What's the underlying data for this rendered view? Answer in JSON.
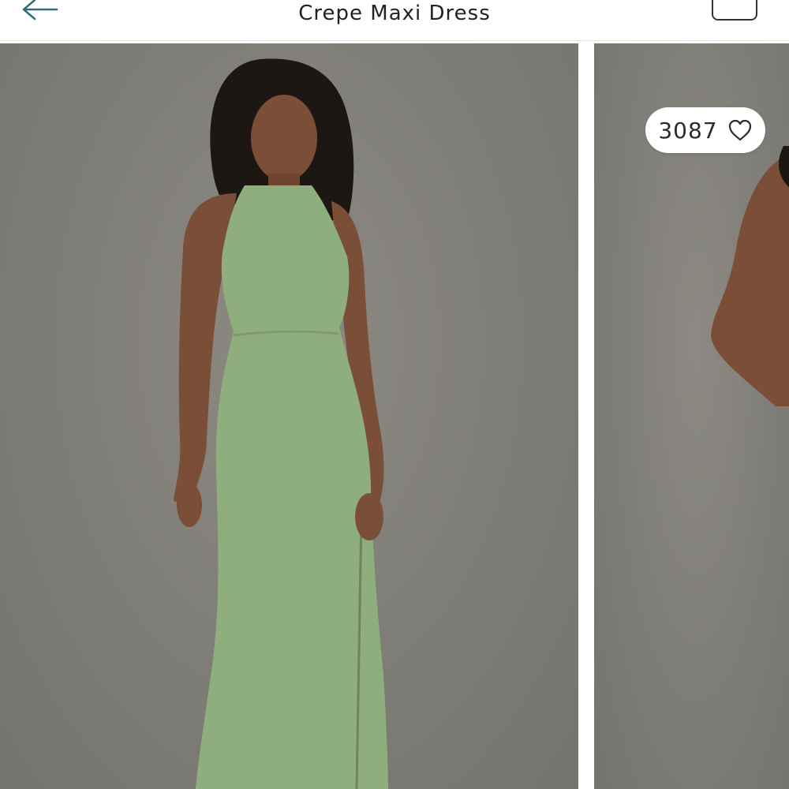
{
  "header": {
    "title": "Crepe Maxi Dress",
    "back_icon": "back-arrow-icon",
    "bag_icon": "shopping-bag-icon"
  },
  "gallery": {
    "images": [
      {
        "label": "green-dress-front-photo"
      },
      {
        "label": "green-dress-back-photo"
      }
    ],
    "likes": {
      "count": "3087",
      "icon": "heart-outline-icon"
    }
  },
  "colors": {
    "accent": "#2f6f7a",
    "dress": "#8fae7e",
    "backdrop": "#807e78"
  }
}
